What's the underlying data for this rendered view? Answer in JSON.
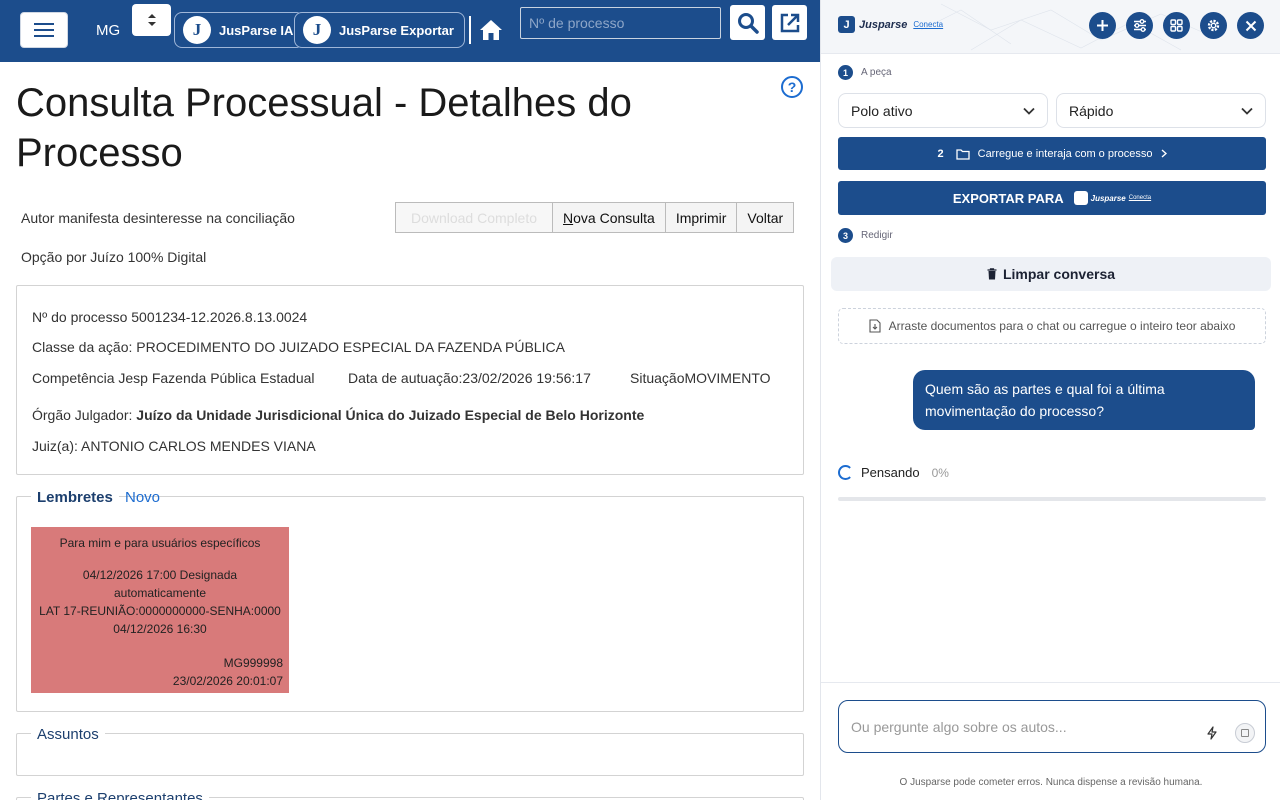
{
  "topbar": {
    "state": "MG",
    "jusparse_ia_label": "JusParse IA",
    "jusparse_export_label": "JusParse Exportar",
    "process_placeholder": "Nº de processo"
  },
  "page": {
    "title_line1": "Consulta Processual - Detalhes do",
    "title_line2": "Processo",
    "note_conciliation": "Autor manifesta desinteresse na conciliação",
    "note_digital": "Opção por Juízo 100% Digital",
    "buttons": {
      "download": "Download Completo",
      "new_query_first": "N",
      "new_query_rest": "ova Consulta",
      "print": "Imprimir",
      "back": "Voltar"
    }
  },
  "process": {
    "number": "Nº do processo 5001234-12.2026.8.13.0024",
    "class": "Classe da ação: PROCEDIMENTO DO JUIZADO ESPECIAL DA FAZENDA PÚBLICA",
    "competence": "Competência Jesp Fazenda Pública Estadual",
    "filing_date": "Data de autuação:23/02/2026 19:56:17",
    "situation": "SituaçãoMOVIMENTO",
    "court_label": "Órgão Julgador: ",
    "court_value": "Juízo da Unidade Jurisdicional Única do Juizado Especial de Belo Horizonte",
    "judge": "Juiz(a): ANTONIO CARLOS MENDES VIANA"
  },
  "reminders": {
    "heading": "Lembretes",
    "new_link": "Novo",
    "card": {
      "audience": "Para mim e para usuários específicos",
      "line1": "04/12/2026 17:00 Designada",
      "line2": "automaticamente",
      "line3": "LAT 17-REUNIÃO:0000000000-SENHA:0000",
      "line4": "04/12/2026 16:30",
      "user": "MG999998",
      "created": "23/02/2026 20:01:07",
      "color": "#d87a7a"
    }
  },
  "sections": {
    "subjects": "Assuntos",
    "parties": "Partes e Representantes"
  },
  "panel": {
    "brand_name": "Jusparse",
    "brand_sub": "Conecta",
    "step1_num": "1",
    "step1_label": "A peça",
    "polo_value": "Polo ativo",
    "mode_value": "Rápido",
    "load_step_num": "2",
    "load_label": "Carregue e interaja com o processo",
    "export_label": "EXPORTAR PARA",
    "export_brand": "Jusparse",
    "export_brand_sub": "Conecta",
    "step3_num": "3",
    "step3_label": "Redigir",
    "clear_label": "Limpar conversa",
    "drop_label": "Arraste documentos para o chat ou carregue o inteiro teor abaixo",
    "user_message_line1": "Quem são as partes e qual foi a última",
    "user_message_line2": "movimentação do processo?",
    "thinking_label": "Pensando",
    "thinking_pct": "0%",
    "progress": 0,
    "input_placeholder": "Ou pergunte algo sobre os autos...",
    "disclaimer": "O Jusparse pode cometer erros. Nunca dispense a revisão humana."
  },
  "colors": {
    "brand_blue": "#1c4d8c",
    "accent_blue": "#1c6cd0"
  },
  "icons": [
    "menu-icon",
    "sort-icon",
    "home-icon",
    "search-icon",
    "open-external-icon",
    "help-icon",
    "plus-icon",
    "sliders-icon",
    "grid-icon",
    "gear-icon",
    "close-icon",
    "chevron-down-icon",
    "folder-icon",
    "chevron-right-icon",
    "trash-icon",
    "upload-file-icon",
    "lightning-icon",
    "stop-icon"
  ]
}
